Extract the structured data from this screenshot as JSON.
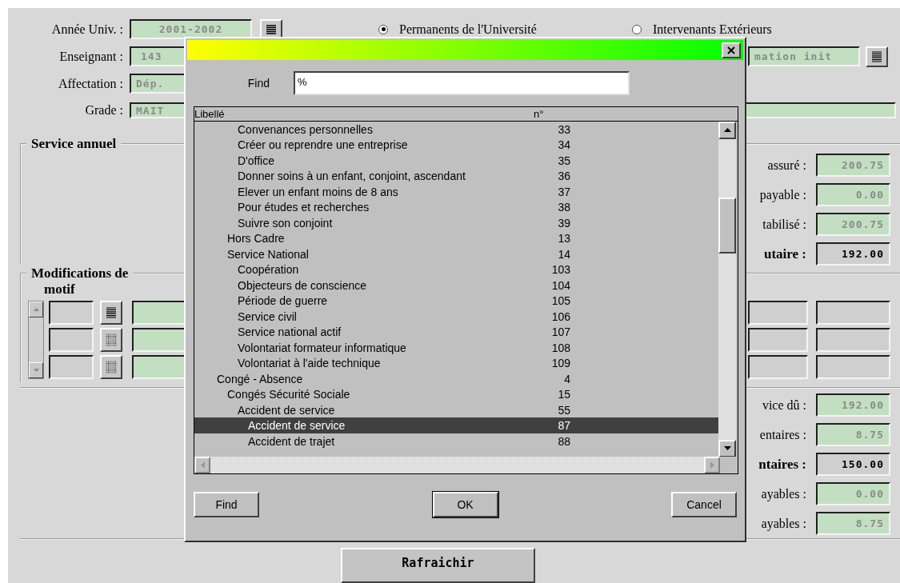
{
  "form": {
    "year": {
      "label": "Année Univ. :",
      "value": "2001-2002"
    },
    "teacher": {
      "label": "Enseignant :",
      "value": "143",
      "status_value": "mation init"
    },
    "assignment": {
      "label": "Affectation :",
      "value": "Dép."
    },
    "grade": {
      "label": "Grade :",
      "value": "MAIT"
    },
    "teacher_type": [
      {
        "label": "Permanents de l'Université",
        "selected": true
      },
      {
        "label": "Intervenants Extérieurs",
        "selected": false
      }
    ]
  },
  "service_annuel": {
    "title": "Service annuel",
    "fields": [
      {
        "label": "assuré :",
        "value": "200.75",
        "kind": "value"
      },
      {
        "label": "payable :",
        "value": "0.00",
        "kind": "value"
      },
      {
        "label": "tabilisé :",
        "value": "200.75",
        "kind": "value"
      },
      {
        "label": "utaire :",
        "value": "192.00",
        "kind": "total"
      }
    ]
  },
  "modifications": {
    "title": "Modifications de",
    "column": "motif",
    "rows": [
      {
        "disabled": false
      },
      {
        "disabled": true
      },
      {
        "disabled": true
      }
    ]
  },
  "totals": {
    "fields": [
      {
        "label": "vice dû :",
        "value": "192.00",
        "kind": "value"
      },
      {
        "label": "entaires :",
        "value": "8.75",
        "kind": "value"
      },
      {
        "label": "ntaires :",
        "value": "150.00",
        "kind": "total"
      },
      {
        "label": "ayables :",
        "value": "0.00",
        "kind": "value"
      },
      {
        "label": "ayables :",
        "value": "8.75",
        "kind": "value"
      }
    ]
  },
  "refresh_button": "Rafraichir",
  "dialog": {
    "find_label": "Find",
    "find_value": "%",
    "columns": [
      "Libellé",
      "n°"
    ],
    "tree": [
      {
        "children": [
          {
            "children": [
              {
                "label": "Convenances personnelles",
                "number": "33",
                "selected": false
              },
              {
                "label": "Créer ou reprendre une entreprise",
                "number": "34",
                "selected": false
              },
              {
                "label": "D'office",
                "number": "35",
                "selected": false
              },
              {
                "label": "Donner soins à un enfant, conjoint, ascendant",
                "number": "36",
                "selected": false
              },
              {
                "label": "Elever un enfant moins de 8 ans",
                "number": "37",
                "selected": false
              },
              {
                "label": "Pour études et recherches",
                "number": "38",
                "selected": false
              },
              {
                "label": "Suivre son conjoint",
                "number": "39",
                "selected": false
              }
            ]
          },
          {
            "label": "Hors Cadre",
            "number": "13",
            "selected": false
          },
          {
            "label": "Service National",
            "number": "14",
            "selected": false,
            "children": [
              {
                "label": "Coopération",
                "number": "103",
                "selected": false
              },
              {
                "label": "Objecteurs de conscience",
                "number": "104",
                "selected": false
              },
              {
                "label": "Période de guerre",
                "number": "105",
                "selected": false
              },
              {
                "label": "Service civil",
                "number": "106",
                "selected": false
              },
              {
                "label": "Service national actif",
                "number": "107",
                "selected": false
              },
              {
                "label": "Volontariat formateur informatique",
                "number": "108",
                "selected": false
              },
              {
                "label": "Volontariat à l'aide technique",
                "number": "109",
                "selected": false
              }
            ]
          }
        ]
      },
      {
        "label": "Congé - Absence",
        "number": "4",
        "selected": false,
        "children": [
          {
            "label": "Congés Sécurité Sociale",
            "number": "15",
            "selected": false,
            "children": [
              {
                "label": "Accident de service",
                "number": "55",
                "selected": false,
                "children": [
                  {
                    "label": "Accident de service",
                    "number": "87",
                    "selected": true
                  },
                  {
                    "label": "Accident de trajet",
                    "number": "88",
                    "selected": false
                  }
                ]
              }
            ]
          }
        ]
      }
    ],
    "buttons": [
      {
        "label": "Find",
        "default": false
      },
      {
        "label": "OK",
        "default": true
      },
      {
        "label": "Cancel",
        "default": false
      }
    ]
  }
}
